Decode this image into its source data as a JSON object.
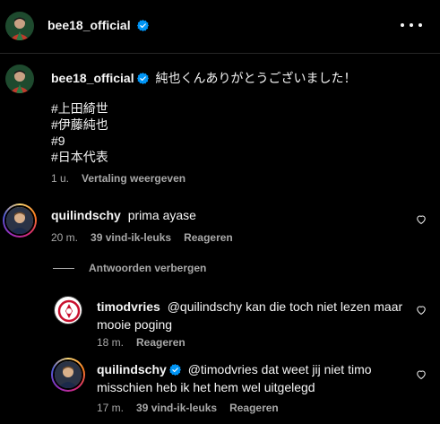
{
  "header": {
    "username": "bee18_official"
  },
  "caption": {
    "username": "bee18_official",
    "text": "純也くんありがとうございました！",
    "hashtags": [
      "#上田綺世",
      "#伊藤純也",
      "#9",
      "#日本代表"
    ],
    "time": "1 u.",
    "translate_label": "Vertaling weergeven"
  },
  "comments": [
    {
      "username": "quilindschy",
      "text": "prima ayase",
      "time": "20 m.",
      "likes": "39 vind-ik-leuks",
      "reply_label": "Reageren"
    }
  ],
  "replies_toggle": "Antwoorden verbergen",
  "replies": [
    {
      "username": "timodvries",
      "text": "@quilindschy kan die toch niet lezen maar mooie poging",
      "time": "18 m.",
      "reply_label": "Reageren"
    },
    {
      "username": "quilindschy",
      "text": "@timodvries dat weet jij niet timo misschien heb ik het hem wel uitgelegd",
      "time": "17 m.",
      "likes": "39 vind-ik-leuks",
      "reply_label": "Reageren"
    }
  ],
  "colors": {
    "background": "#000000",
    "text": "#f5f5f5",
    "secondary": "#a8a8a8",
    "verified": "#0095f6"
  },
  "icons": {
    "more": "more-options-icon",
    "verified": "verified-badge-icon",
    "like": "heart-outline-icon"
  }
}
